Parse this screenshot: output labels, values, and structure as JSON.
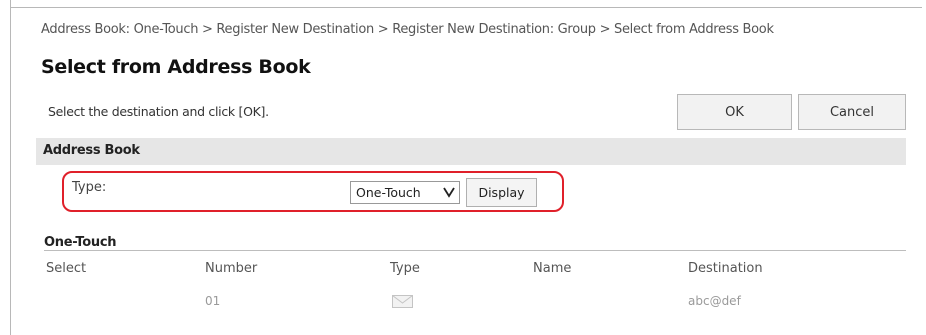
{
  "breadcrumb": "Address Book: One-Touch > Register New Destination > Register New Destination: Group > Select from Address Book",
  "page_title": "Select from Address Book",
  "instruction": "Select the destination and click [OK].",
  "buttons": {
    "ok": "OK",
    "cancel": "Cancel",
    "display": "Display"
  },
  "address_book": {
    "header": "Address Book",
    "type_label": "Type:",
    "type_selected": "One-Touch"
  },
  "one_touch": {
    "header": "One-Touch",
    "columns": [
      "Select",
      "Number",
      "Type",
      "Name",
      "Destination"
    ],
    "rows": [
      {
        "select": "",
        "number": "01",
        "type_icon": "envelope-icon",
        "name": "",
        "destination": "abc@def"
      }
    ]
  },
  "colors": {
    "highlight": "#e0202a",
    "section_bg": "#e6e6e6"
  }
}
